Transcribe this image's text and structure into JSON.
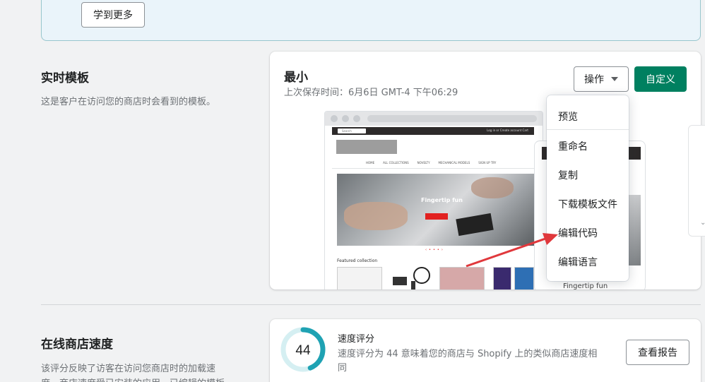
{
  "banner": {
    "learn_more_label": "学到更多"
  },
  "live_theme": {
    "section_title": "实时模板",
    "section_desc": "这是客户在访问您的商店时会看到的模板。",
    "theme_name": "最小",
    "last_saved": "上次保存时间：6月6日 GMT-4 下午06:29",
    "actions_label": "操作",
    "customize_label": "自定义",
    "preview": {
      "search_placeholder": "Search",
      "login_text": "Log in  or  Create account   Cart",
      "nav": [
        "HOME",
        "ALL COLLECTIONS",
        "NOVELTY",
        "MECHANICAL MODELS",
        "SIGN UP TRY"
      ],
      "hero_title": "Fingertip fun",
      "featured": "Featured collection",
      "mobile_text": "Fingertip fun"
    },
    "dropdown_items": [
      "预览",
      "重命名",
      "复制",
      "下载模板文件",
      "编辑代码",
      "编辑语言"
    ]
  },
  "speed": {
    "section_title": "在线商店速度",
    "section_desc_line1": "该评分反映了访客在访问您商店时的加载速",
    "section_desc_line2": "度。商店速度受已安装的应用、已编辑的模板",
    "score": "44",
    "score_value": 44,
    "label": "速度评分",
    "description": "速度评分为 44 意味着您的商店与 Shopify 上的类似商店速度相同",
    "report_label": "查看报告"
  },
  "colors": {
    "primary": "#008060",
    "gauge": "#1fa2b3",
    "arrow": "#e0383c"
  }
}
